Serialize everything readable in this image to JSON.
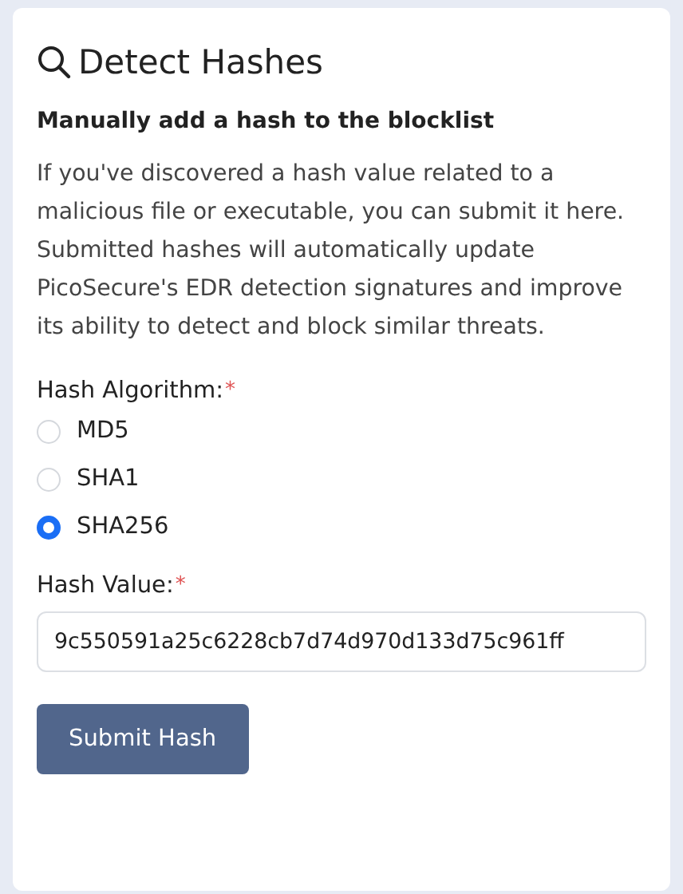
{
  "title": "Detect Hashes",
  "subtitle": "Manually add a hash to the blocklist",
  "description": "If you've discovered a hash value related to a malicious file or executable, you can submit it here. Submitted hashes will automatically update PicoSecure's EDR detection signatures and improve its ability to detect and block similar threats.",
  "algorithm": {
    "label": "Hash Algorithm:",
    "required_mark": "*",
    "options": [
      {
        "label": "MD5",
        "selected": false
      },
      {
        "label": "SHA1",
        "selected": false
      },
      {
        "label": "SHA256",
        "selected": true
      }
    ]
  },
  "hash_value": {
    "label": "Hash Value:",
    "required_mark": "*",
    "value": "9c550591a25c6228cb7d74d970d133d75c961ff"
  },
  "submit_button": "Submit Hash"
}
